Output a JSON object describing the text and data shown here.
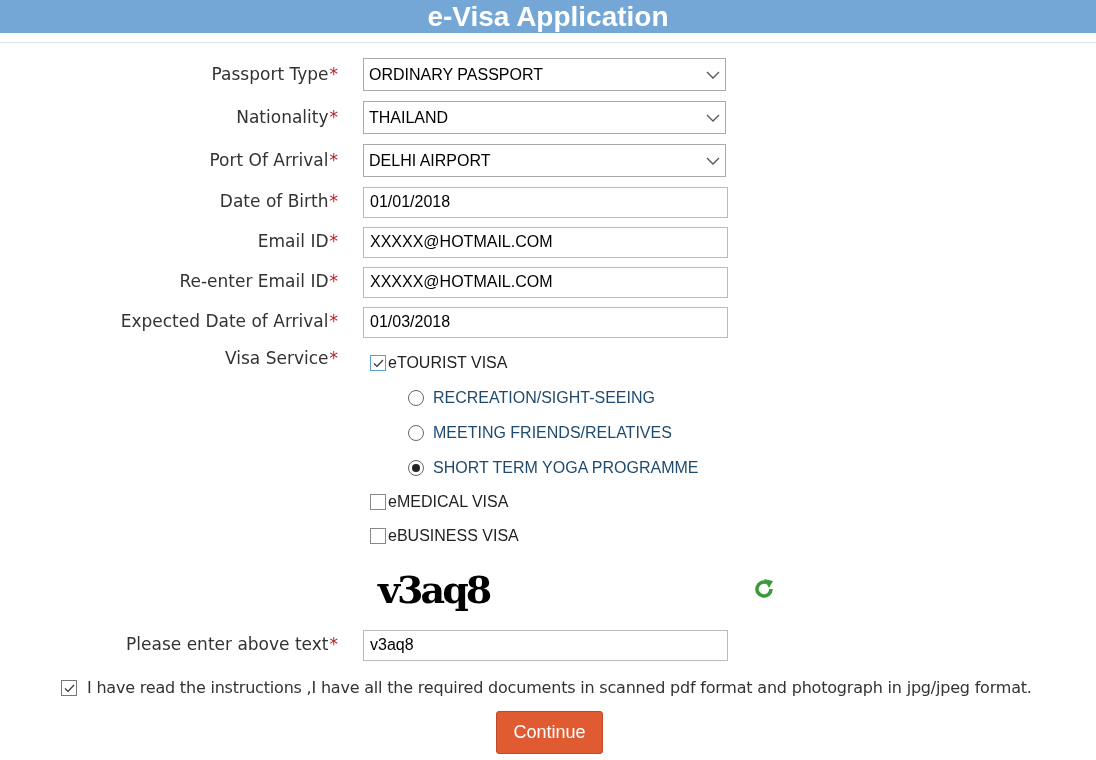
{
  "header": {
    "title": "e-Visa Application"
  },
  "fields": [
    {
      "kind": "select",
      "label": "Passport Type",
      "required_mark": "*",
      "value": "ORDINARY PASSPORT"
    },
    {
      "kind": "select",
      "label": "Nationality",
      "required_mark": "*",
      "value": "THAILAND"
    },
    {
      "kind": "select",
      "label": "Port Of Arrival",
      "required_mark": "*",
      "value": "DELHI AIRPORT"
    },
    {
      "kind": "input",
      "label": "Date of Birth",
      "required_mark": "*",
      "value": "01/01/2018"
    },
    {
      "kind": "input",
      "label": "Email ID",
      "required_mark": "*",
      "value": "XXXXX@HOTMAIL.COM"
    },
    {
      "kind": "input",
      "label": "Re-enter Email ID",
      "required_mark": "*",
      "value": "XXXXX@HOTMAIL.COM"
    },
    {
      "kind": "input",
      "label": "Expected Date of Arrival",
      "required_mark": "*",
      "value": "01/03/2018"
    }
  ],
  "visa_service": {
    "label": "Visa Service",
    "required_mark": "*",
    "options": [
      {
        "label": "eTOURIST VISA",
        "checked": true,
        "purposes": [
          {
            "label": "RECREATION/SIGHT-SEEING",
            "selected": false
          },
          {
            "label": "MEETING FRIENDS/RELATIVES",
            "selected": false
          },
          {
            "label": "SHORT TERM YOGA PROGRAMME",
            "selected": true
          }
        ]
      },
      {
        "label": "eMEDICAL VISA",
        "checked": false
      },
      {
        "label": "eBUSINESS VISA",
        "checked": false
      }
    ]
  },
  "captcha": {
    "text": "v3aq8",
    "label": "Please enter above text",
    "required_mark": "*",
    "value": "v3aq8"
  },
  "agreement": {
    "text": "I have read the instructions ,I have all the required documents in scanned pdf format and photograph in jpg/jpeg format.",
    "checked": true
  },
  "submit": {
    "label": "Continue"
  }
}
